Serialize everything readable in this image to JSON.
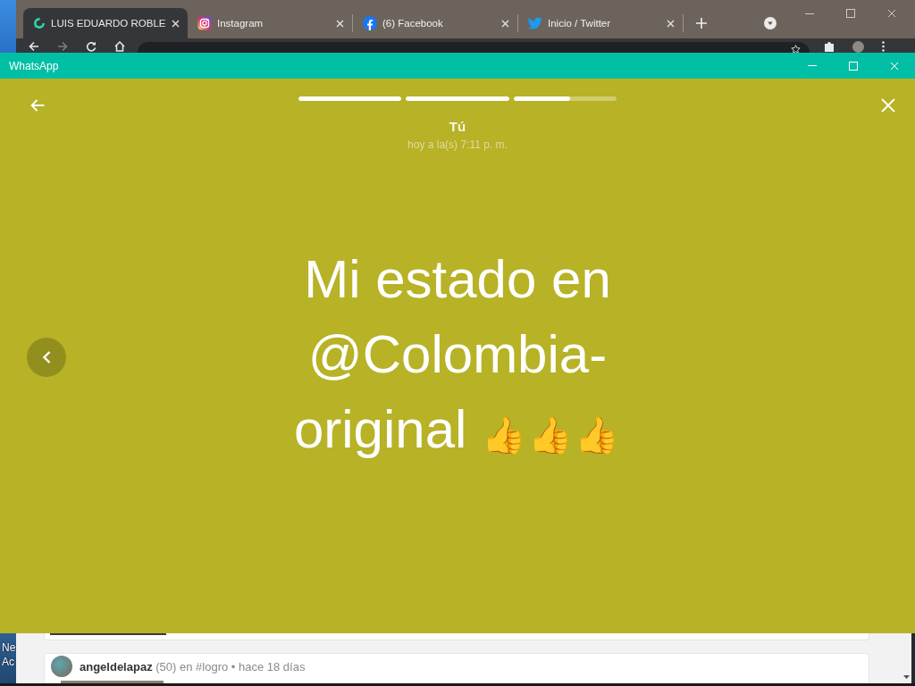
{
  "browser": {
    "tabs": [
      {
        "title": "LUIS EDUARDO ROBLE",
        "kind": "swirl",
        "selected": true
      },
      {
        "title": "Instagram",
        "kind": "camera",
        "selected": false
      },
      {
        "title": "(6) Facebook",
        "kind": "f_circle",
        "selected": false
      },
      {
        "title": "Inicio / Twitter",
        "kind": "bird",
        "selected": false
      }
    ]
  },
  "whatsapp": {
    "title": "WhatsApp",
    "status": {
      "segments": [
        {
          "level": 1
        },
        {
          "level": 1
        },
        {
          "level": 0.55
        }
      ],
      "author": "Tú",
      "time": "hoy a la(s) 7:11 p. m.",
      "text": "Mi estado en @Colombia-original 👍👍👍"
    }
  },
  "desktop": {
    "icon_labels": [
      "Ne",
      "Ac"
    ]
  },
  "page": {
    "post": {
      "byline": "**angeldelapaz** (50) en #logro • hace 18 días"
    }
  }
}
